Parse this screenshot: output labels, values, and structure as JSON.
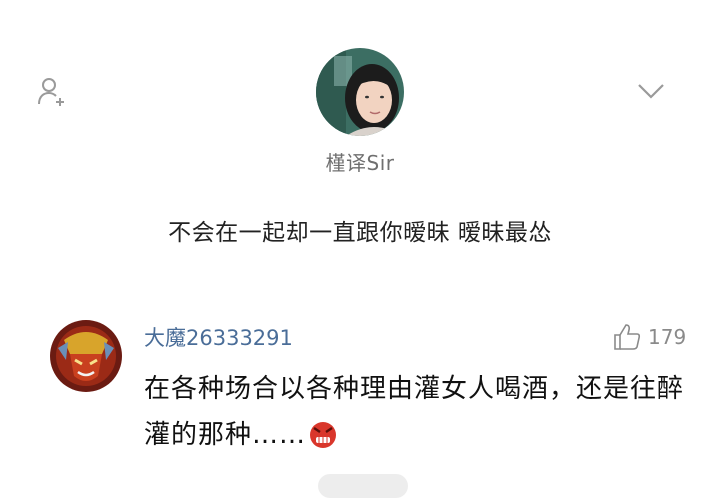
{
  "profile": {
    "name": "槿译Sir",
    "bio": "不会在一起却一直跟你暧昧 暧昧最怂"
  },
  "icons": {
    "follow": "add-user-icon",
    "more": "chevron-down-icon",
    "like": "thumbs-up-icon",
    "emoji": "angry-face-emoji-icon"
  },
  "comment": {
    "author": "大魔26333291",
    "likes": "179",
    "text": "在各种场合以各种理由灌女人喝酒，还是往醉灌的那种……"
  },
  "colors": {
    "author_link": "#4a6d98",
    "muted": "#8a8a8a"
  }
}
